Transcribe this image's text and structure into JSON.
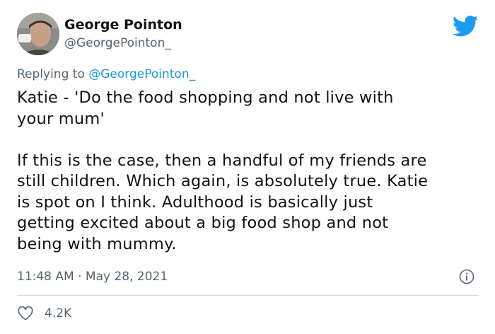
{
  "tweet": {
    "author_name": "George Pointon",
    "author_handle": "@GeorgePointon_",
    "replying_prefix": "Replying to",
    "replying_handle": "@GeorgePointon_",
    "text": "Katie - 'Do the food shopping and not live with\nyour mum'\n\nIf this is the case, then a handful of my friends are\nstill children. Which again, is absolutely true. Katie\nis spot on I think. Adulthood is basically just\ngetting excited about a big food shop and not\nbeing with mummy.",
    "timestamp": "11:48 AM · May 28, 2021",
    "like_count": "4.2K"
  },
  "icons": {
    "brand": "twitter-bird-icon",
    "info": "info-icon",
    "like": "heart-icon"
  },
  "colors": {
    "brand_blue": "#1d9bf0",
    "mention_blue": "#1b95e0",
    "secondary_text": "#536471"
  }
}
